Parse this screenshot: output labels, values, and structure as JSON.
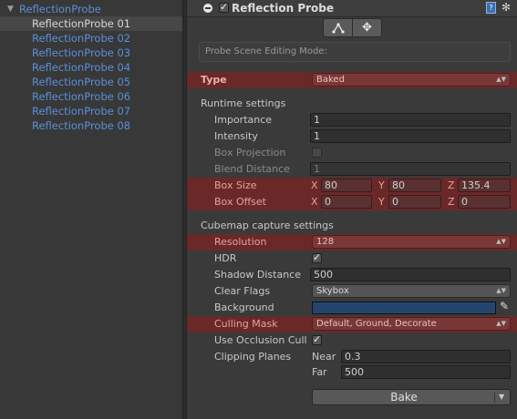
{
  "hierarchy": {
    "root": "ReflectionProbe",
    "items": [
      "ReflectionProbe 01",
      "ReflectionProbe 02",
      "ReflectionProbe 03",
      "ReflectionProbe 04",
      "ReflectionProbe 05",
      "ReflectionProbe 06",
      "ReflectionProbe 07",
      "ReflectionProbe 08"
    ],
    "selected_index": 0
  },
  "component": {
    "title": "Reflection Probe",
    "enabled": true,
    "toolbar": {
      "edit_bounds_icon": "bounds-edit-icon",
      "move_icon": "move-arrows-icon"
    },
    "mode_box": "Probe Scene Editing Mode:",
    "type": {
      "label": "Type",
      "value": "Baked"
    },
    "runtime": {
      "header": "Runtime settings",
      "importance": {
        "label": "Importance",
        "value": "1"
      },
      "intensity": {
        "label": "Intensity",
        "value": "1"
      },
      "box_projection": {
        "label": "Box Projection",
        "checked": false
      },
      "blend_distance": {
        "label": "Blend Distance",
        "value": "1"
      },
      "box_size": {
        "label": "Box Size",
        "x_label": "X",
        "x": "80",
        "y_label": "Y",
        "y": "80",
        "z_label": "Z",
        "z": "135.4"
      },
      "box_offset": {
        "label": "Box Offset",
        "x_label": "X",
        "x": "0",
        "y_label": "Y",
        "y": "0",
        "z_label": "Z",
        "z": "0"
      }
    },
    "cubemap": {
      "header": "Cubemap capture settings",
      "resolution": {
        "label": "Resolution",
        "value": "128"
      },
      "hdr": {
        "label": "HDR",
        "checked": true
      },
      "shadow_distance": {
        "label": "Shadow Distance",
        "value": "500"
      },
      "clear_flags": {
        "label": "Clear Flags",
        "value": "Skybox"
      },
      "background": {
        "label": "Background",
        "color": "#24466e"
      },
      "culling_mask": {
        "label": "Culling Mask",
        "value": "Default, Ground, Decorate"
      },
      "use_occlusion": {
        "label": "Use Occlusion Cull",
        "checked": true
      },
      "clipping": {
        "label": "Clipping Planes",
        "near_label": "Near",
        "near": "0.3",
        "far_label": "Far",
        "far": "500"
      }
    },
    "bake_button": "Bake"
  },
  "colors": {
    "highlight_red": "#6b2828",
    "link_blue": "#5b8fd8"
  }
}
